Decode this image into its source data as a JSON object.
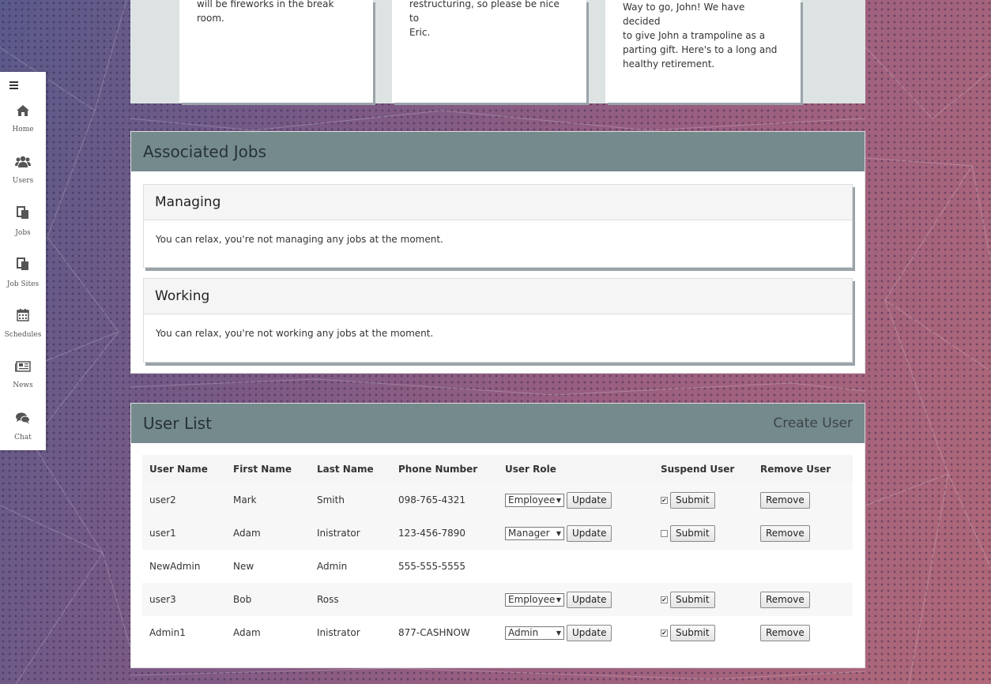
{
  "sidebar": {
    "menu_icon": "hamburger-icon",
    "items": [
      {
        "label": "Home",
        "icon": "home-icon"
      },
      {
        "label": "Users",
        "icon": "users-icon"
      },
      {
        "label": "Jobs",
        "icon": "jobs-icon"
      },
      {
        "label": "Job Sites",
        "icon": "job-sites-icon"
      },
      {
        "label": "Schedules",
        "icon": "calendar-icon"
      },
      {
        "label": "News",
        "icon": "newspaper-icon"
      },
      {
        "label": "Chat",
        "icon": "chat-icon"
      }
    ]
  },
  "news": {
    "cards": [
      {
        "lines": [
          "will be fireworks in the break",
          "room."
        ]
      },
      {
        "lines": [
          "restructuring, so please be nice to",
          "Eric."
        ]
      },
      {
        "lines": [
          "Way to go, John! We have decided",
          "to give John a trampoline as a",
          "parting gift. Here's to a long and",
          "healthy retirement."
        ]
      }
    ]
  },
  "associated_jobs": {
    "title": "Associated Jobs",
    "managing": {
      "title": "Managing",
      "message": "You can relax, you're not managing any jobs at the moment."
    },
    "working": {
      "title": "Working",
      "message": "You can relax, you're not working any jobs at the moment."
    }
  },
  "user_list": {
    "title": "User List",
    "create_label": "Create User",
    "columns": [
      "User Name",
      "First Name",
      "Last Name",
      "Phone Number",
      "User Role",
      "Suspend User",
      "Remove User"
    ],
    "update_label": "Update",
    "submit_label": "Submit",
    "remove_label": "Remove",
    "rows": [
      {
        "username": "user2",
        "first": "Mark",
        "last": "Smith",
        "phone": "098-765-4321",
        "role": "Employee",
        "suspended": true,
        "editable": true
      },
      {
        "username": "user1",
        "first": "Adam",
        "last": "Inistrator",
        "phone": "123-456-7890",
        "role": "Manager",
        "suspended": false,
        "editable": true
      },
      {
        "username": "NewAdmin",
        "first": "New",
        "last": "Admin",
        "phone": "555-555-5555",
        "role": "",
        "suspended": false,
        "editable": false
      },
      {
        "username": "user3",
        "first": "Bob",
        "last": "Ross",
        "phone": "",
        "role": "Employee",
        "suspended": true,
        "editable": true
      },
      {
        "username": "Admin1",
        "first": "Adam",
        "last": "Inistrator",
        "phone": "877-CASHNOW",
        "role": "Admin",
        "suspended": true,
        "editable": true
      }
    ]
  }
}
